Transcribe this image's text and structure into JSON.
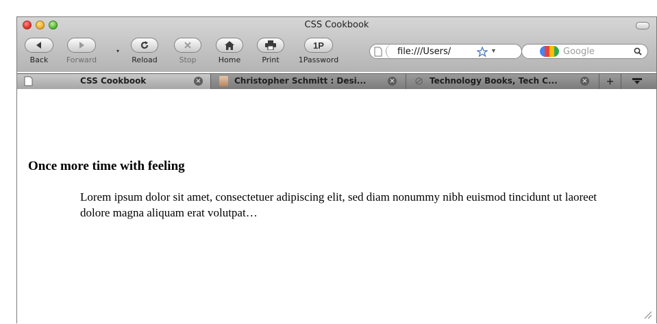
{
  "window": {
    "title": "CSS Cookbook",
    "traffic_lights": [
      "close-icon",
      "minimize-icon",
      "zoom-icon"
    ]
  },
  "toolbar": {
    "back_label": "Back",
    "forward_label": "Forward",
    "reload_label": "Reload",
    "stop_label": "Stop",
    "home_label": "Home",
    "print_label": "Print",
    "onepassword_label": "1Password",
    "onepassword_icon_text": "1P",
    "url": "file:///Users/",
    "search_placeholder": "Google"
  },
  "tabs": [
    {
      "title": "CSS Cookbook",
      "active": true
    },
    {
      "title": "Christopher Schmitt : Desi...",
      "active": false
    },
    {
      "title": "Technology Books, Tech C...",
      "active": false
    }
  ],
  "page": {
    "heading": "Once more time with feeling",
    "paragraph": "Lorem ipsum dolor sit amet, consectetuer adipiscing elit, sed diam nonummy nibh euismod tincidunt ut laoreet dolore magna aliquam erat volutpat…"
  },
  "colors": {
    "chrome": "#c4c4c4",
    "tab_strip": "#8a8a8a",
    "active_tab": "#b8b8b8",
    "page_background": "#ffffff",
    "text": "#000000"
  }
}
